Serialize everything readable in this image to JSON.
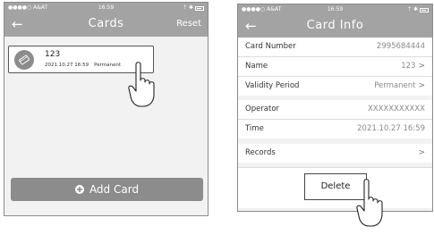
{
  "left_screen": {
    "status": {
      "carrier": "●●●●○ A&AT",
      "time": "16:59",
      "icons": "⇡ ✱"
    },
    "nav": {
      "back_icon": "arrow-left-icon",
      "title": "Cards",
      "reset_label": "Reset"
    },
    "card": {
      "name": "123",
      "timestamp": "2021.10.27 16:59",
      "validity": "Permanent",
      "icon": "card-icon"
    },
    "add_card": {
      "label": "Add Card",
      "icon": "plus-circle-icon"
    }
  },
  "right_screen": {
    "status": {
      "carrier": "●●●●○ A&AT",
      "time": "16:59",
      "icons": "⇡ ✱"
    },
    "nav": {
      "back_icon": "arrow-left-icon",
      "title": "Card Info"
    },
    "rows": [
      {
        "key": "Card Number",
        "value": "2995684444"
      },
      {
        "key": "Name",
        "value": "123",
        "chevron": true
      },
      {
        "key": "Validity Period",
        "value": "Permanent",
        "chevron": true
      },
      {
        "key": "Operator",
        "value": "XXXXXXXXXXX"
      },
      {
        "key": "Time",
        "value": "2021.10.27 16:59"
      },
      {
        "key": "Records",
        "value": "",
        "chevron": true
      }
    ],
    "delete_label": "Delete"
  },
  "colors": {
    "header": "#a3a3a3",
    "button": "#8c8c8c",
    "background": "#f2f2f2"
  }
}
